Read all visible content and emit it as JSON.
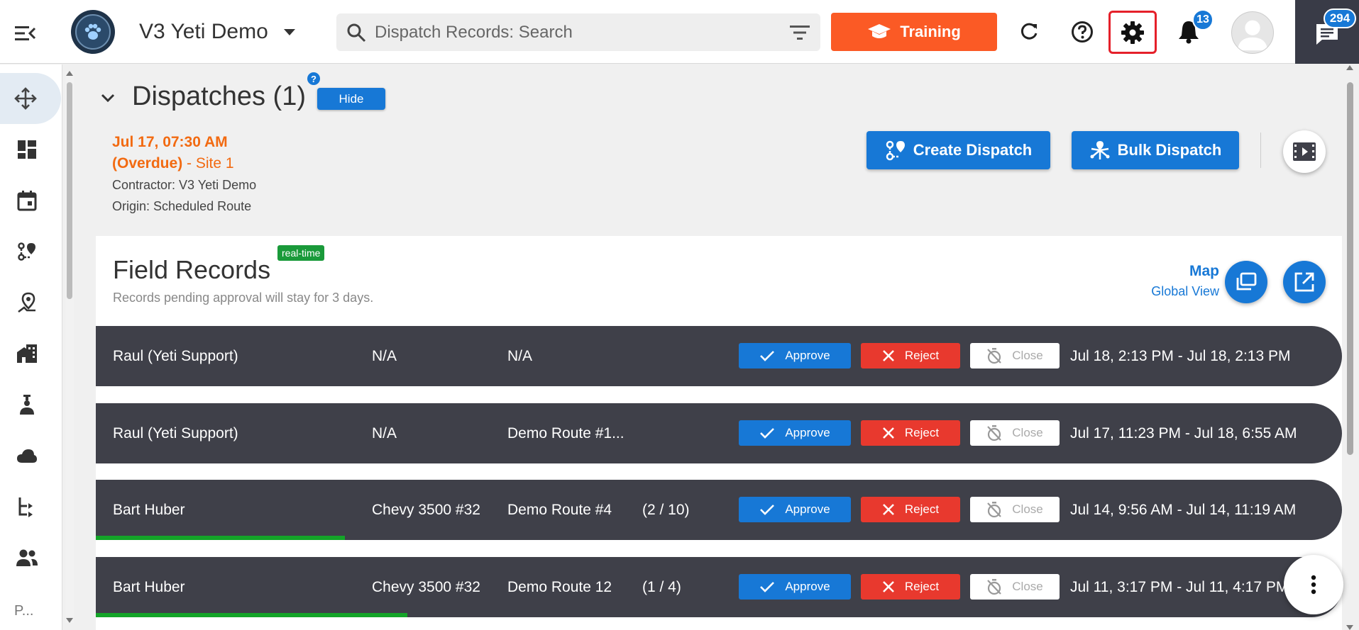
{
  "header": {
    "app_title": "V3 Yeti Demo",
    "search_placeholder": "Dispatch Records: Search",
    "training_label": "Training",
    "notifications_count": "13",
    "messages_count": "294",
    "accent_color": "#1778d6",
    "training_color": "#fb5a25"
  },
  "sidebar": {
    "items": [
      {
        "icon": "routes-move-icon",
        "active": true
      },
      {
        "icon": "dashboard-icon"
      },
      {
        "icon": "calendar-icon"
      },
      {
        "icon": "route-map-icon"
      },
      {
        "icon": "map-pin-icon"
      },
      {
        "icon": "buildings-icon"
      },
      {
        "icon": "worker-icon"
      },
      {
        "icon": "cloud-icon"
      },
      {
        "icon": "hierarchy-icon"
      },
      {
        "icon": "people-icon"
      }
    ],
    "footer_label": "P..."
  },
  "dispatches": {
    "title": "Dispatches (1)",
    "help": "?",
    "hide_label": "Hide",
    "card": {
      "datetime": "Jul 17, 07:30 AM",
      "status": "(Overdue)",
      "site": " - Site 1",
      "contractor": "Contractor: V3 Yeti Demo",
      "origin": "Origin: Scheduled Route"
    },
    "create_label": "Create Dispatch",
    "bulk_label": "Bulk Dispatch"
  },
  "field_records": {
    "title": "Field Records",
    "realtime_badge": "real-time",
    "subtitle": "Records pending approval will stay for 3 days.",
    "map_label": "Map",
    "global_view_label": "Global View",
    "actions": {
      "approve": "Approve",
      "reject": "Reject",
      "close": "Close"
    },
    "rows": [
      {
        "name": "Raul (Yeti Support)",
        "vehicle": "N/A",
        "route": "N/A",
        "count": "",
        "dates": "Jul 18, 2:13 PM  -  Jul 18, 2:13 PM",
        "progress": 0
      },
      {
        "name": "Raul (Yeti Support)",
        "vehicle": "N/A",
        "route": "Demo Route #1...",
        "count": "",
        "dates": "Jul 17, 11:23 PM  -  Jul 18, 6:55 AM",
        "progress": 0
      },
      {
        "name": "Bart Huber",
        "vehicle": "Chevy 3500 #32",
        "route": "Demo Route #4",
        "count": "(2 / 10)",
        "dates": "Jul 14, 9:56 AM  -  Jul 14, 11:19 AM",
        "progress": 0.2
      },
      {
        "name": "Bart Huber",
        "vehicle": "Chevy 3500 #32",
        "route": "Demo Route 12",
        "count": "(1 / 4)",
        "dates": "Jul 11, 3:17 PM  -  Jul 11, 4:17 PM",
        "progress": 0.25
      }
    ]
  }
}
